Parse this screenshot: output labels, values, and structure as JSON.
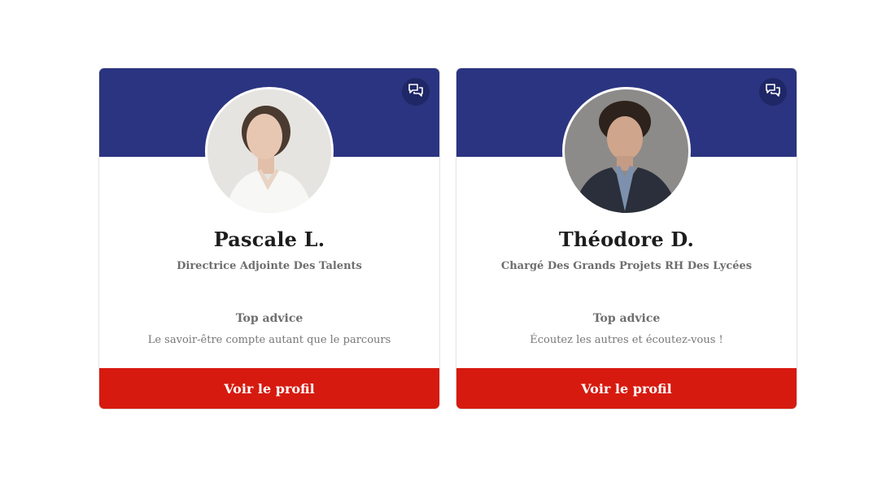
{
  "colors": {
    "banner": "#2b3480",
    "chat_button": "#1f2766",
    "cta": "#d71a0f",
    "name_text": "#1d1d1d",
    "muted_text": "#6e6e6e"
  },
  "cards": [
    {
      "name": "Pascale L.",
      "title": "Directrice Adjointe Des Talents",
      "advice_label": "Top advice",
      "advice_text": "Le savoir-être compte autant que le parcours",
      "cta_label": "Voir le profil",
      "chat_icon": "chat-bubbles-icon",
      "photo": "portrait-photo"
    },
    {
      "name": "Théodore D.",
      "title": "Chargé Des Grands Projets RH Des Lycées",
      "advice_label": "Top advice",
      "advice_text": "Écoutez les autres et écoutez-vous !",
      "cta_label": "Voir le profil",
      "chat_icon": "chat-bubbles-icon",
      "photo": "portrait-photo"
    }
  ]
}
